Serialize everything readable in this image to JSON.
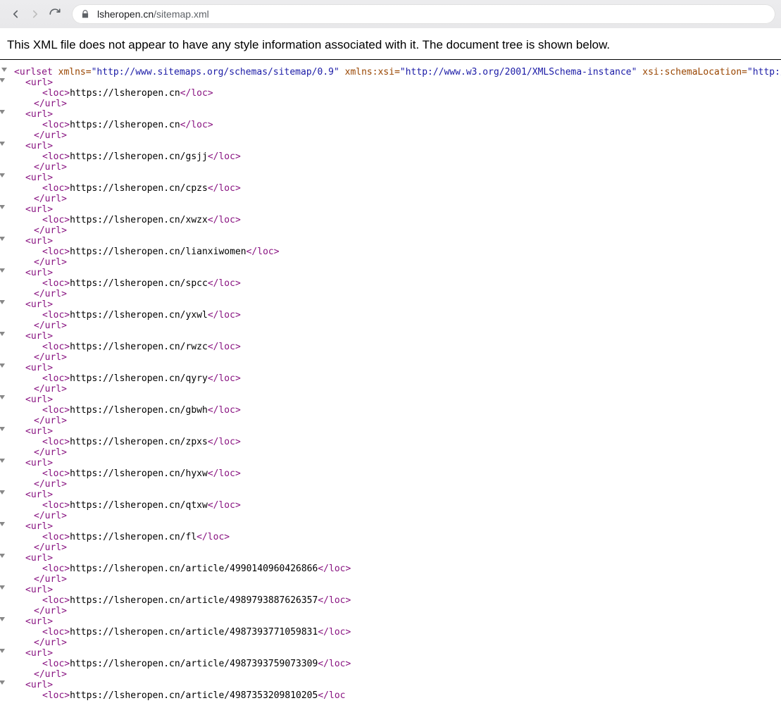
{
  "toolbar": {
    "url_host": "lsheropen.cn",
    "url_path": "/sitemap.xml"
  },
  "header": {
    "message": "This XML file does not appear to have any style information associated with it. The document tree is shown below."
  },
  "xml": {
    "root_tag": "urlset",
    "root_attrs": [
      {
        "name": "xmlns",
        "value": "http://www.sitemaps.org/schemas/sitemap/0.9"
      },
      {
        "name": "xmlns:xsi",
        "value": "http://www.w3.org/2001/XMLSchema-instance"
      },
      {
        "name": "xsi:schemaLocation",
        "value": "http://www.sitemaps.or"
      }
    ],
    "url_tag": "url",
    "loc_tag": "loc",
    "entries": [
      {
        "loc": "https://lsheropen.cn"
      },
      {
        "loc": "https://lsheropen.cn"
      },
      {
        "loc": "https://lsheropen.cn/gsjj"
      },
      {
        "loc": "https://lsheropen.cn/cpzs"
      },
      {
        "loc": "https://lsheropen.cn/xwzx"
      },
      {
        "loc": "https://lsheropen.cn/lianxiwomen"
      },
      {
        "loc": "https://lsheropen.cn/spcc"
      },
      {
        "loc": "https://lsheropen.cn/yxwl"
      },
      {
        "loc": "https://lsheropen.cn/rwzc"
      },
      {
        "loc": "https://lsheropen.cn/qyry"
      },
      {
        "loc": "https://lsheropen.cn/gbwh"
      },
      {
        "loc": "https://lsheropen.cn/zpxs"
      },
      {
        "loc": "https://lsheropen.cn/hyxw"
      },
      {
        "loc": "https://lsheropen.cn/qtxw"
      },
      {
        "loc": "https://lsheropen.cn/fl"
      },
      {
        "loc": "https://lsheropen.cn/article/4990140960426866"
      },
      {
        "loc": "https://lsheropen.cn/article/4989793887626357"
      },
      {
        "loc": "https://lsheropen.cn/article/4987393771059831"
      },
      {
        "loc": "https://lsheropen.cn/article/4987393759073309"
      }
    ],
    "trailing_partial_open_url": true,
    "trailing_partial_loc": "https://lsheropen.cn/article/4987353209810205",
    "trailing_partial_close_loc": "</loc"
  }
}
